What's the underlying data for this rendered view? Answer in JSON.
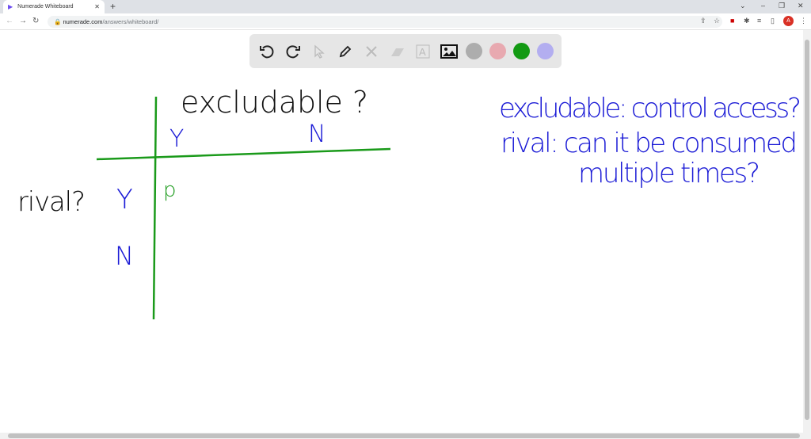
{
  "browser": {
    "tab_title": "Numerade Whiteboard",
    "url_host": "numerade.com",
    "url_path": "/answers/whiteboard/",
    "avatar_letter": "A"
  },
  "toolbar": {
    "tools": [
      "undo-icon",
      "redo-icon",
      "pointer-icon",
      "pen-icon",
      "tools-icon",
      "eraser-icon",
      "text-icon",
      "image-icon"
    ],
    "colors": [
      "#adadad",
      "#e8a9b0",
      "#139a13",
      "#b3aef0"
    ]
  },
  "board": {
    "title": "excludable ?",
    "col_y": "Y",
    "col_n": "N",
    "row_label": "rival?",
    "row_y": "Y",
    "row_n": "N",
    "cell_yy": "p",
    "note1": "excludable: control access?",
    "note2": "rival: can it be consumed",
    "note3": "multiple times?",
    "ink_black": "#111111",
    "ink_blue": "#1b1bd6",
    "ink_green": "#1a9a1a"
  }
}
